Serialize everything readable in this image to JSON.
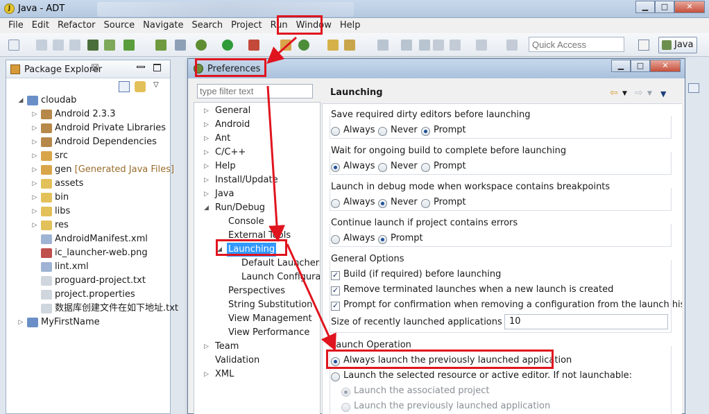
{
  "window": {
    "title": "Java - ADT",
    "app_icon_glyph": "J"
  },
  "menu": [
    "File",
    "Edit",
    "Refactor",
    "Source",
    "Navigate",
    "Search",
    "Project",
    "Run",
    "Window",
    "Help"
  ],
  "toolbar": {
    "quick_access_placeholder": "Quick Access",
    "perspective_label": "Java"
  },
  "package_explorer": {
    "tab_label": "Package Explorer",
    "tab_close": "☒",
    "items": [
      {
        "label": "cloudab",
        "level": 0,
        "arrow": "◢",
        "icon_color": "#6a8fc7"
      },
      {
        "label": "Android 2.3.3",
        "level": 1,
        "arrow": "▷",
        "icon_color": "#b6884a"
      },
      {
        "label": "Android Private Libraries",
        "level": 1,
        "arrow": "▷",
        "icon_color": "#b6884a"
      },
      {
        "label": "Android Dependencies",
        "level": 1,
        "arrow": "▷",
        "icon_color": "#b6884a"
      },
      {
        "label": "src",
        "level": 1,
        "arrow": "▷",
        "icon_color": "#d9a54a"
      },
      {
        "label": "gen",
        "decor": "[Generated Java Files]",
        "level": 1,
        "arrow": "▷",
        "icon_color": "#d9a54a"
      },
      {
        "label": "assets",
        "level": 1,
        "arrow": "▷",
        "icon_color": "#e3c15a"
      },
      {
        "label": "bin",
        "level": 1,
        "arrow": "▷",
        "icon_color": "#e3c15a"
      },
      {
        "label": "libs",
        "level": 1,
        "arrow": "▷",
        "icon_color": "#e3c15a"
      },
      {
        "label": "res",
        "level": 1,
        "arrow": "▷",
        "icon_color": "#e3c15a"
      },
      {
        "label": "AndroidManifest.xml",
        "level": 1,
        "arrow": "",
        "icon_color": "#9fb4d4"
      },
      {
        "label": "ic_launcher-web.png",
        "level": 1,
        "arrow": "",
        "icon_color": "#c0504d"
      },
      {
        "label": "lint.xml",
        "level": 1,
        "arrow": "",
        "icon_color": "#9fb4d4"
      },
      {
        "label": "proguard-project.txt",
        "level": 1,
        "arrow": "",
        "icon_color": "#d0d6de"
      },
      {
        "label": "project.properties",
        "level": 1,
        "arrow": "",
        "icon_color": "#d0d6de"
      },
      {
        "label": "数据库创建文件在如下地址.txt",
        "level": 1,
        "arrow": "",
        "icon_color": "#d0d6de"
      },
      {
        "label": "MyFirstName",
        "level": 0,
        "arrow": "▷",
        "icon_color": "#6a8fc7"
      }
    ]
  },
  "preferences": {
    "title": "Preferences",
    "filter_placeholder": "type filter text",
    "tree": [
      {
        "label": "General",
        "level": 0,
        "arrow": "▷"
      },
      {
        "label": "Android",
        "level": 0,
        "arrow": "▷"
      },
      {
        "label": "Ant",
        "level": 0,
        "arrow": "▷"
      },
      {
        "label": "C/C++",
        "level": 0,
        "arrow": "▷"
      },
      {
        "label": "Help",
        "level": 0,
        "arrow": "▷"
      },
      {
        "label": "Install/Update",
        "level": 0,
        "arrow": "▷"
      },
      {
        "label": "Java",
        "level": 0,
        "arrow": "▷"
      },
      {
        "label": "Run/Debug",
        "level": 0,
        "arrow": "◢"
      },
      {
        "label": "Console",
        "level": 1,
        "arrow": ""
      },
      {
        "label": "External Tools",
        "level": 1,
        "arrow": ""
      },
      {
        "label": "Launching",
        "level": 1,
        "arrow": "◢",
        "selected": true
      },
      {
        "label": "Default Launchers",
        "level": 2,
        "arrow": ""
      },
      {
        "label": "Launch Configurations",
        "level": 2,
        "arrow": ""
      },
      {
        "label": "Perspectives",
        "level": 1,
        "arrow": ""
      },
      {
        "label": "String Substitution",
        "level": 1,
        "arrow": ""
      },
      {
        "label": "View Management",
        "level": 1,
        "arrow": ""
      },
      {
        "label": "View Performance",
        "level": 1,
        "arrow": ""
      },
      {
        "label": "Team",
        "level": 0,
        "arrow": "▷"
      },
      {
        "label": "Validation",
        "level": 0,
        "arrow": ""
      },
      {
        "label": "XML",
        "level": 0,
        "arrow": "▷"
      }
    ],
    "page_title": "Launching",
    "save_dirty": {
      "title": "Save required dirty editors before launching",
      "options": [
        "Always",
        "Never",
        "Prompt"
      ],
      "selected": "Prompt"
    },
    "wait_build": {
      "title": "Wait for ongoing build to complete before launching",
      "options": [
        "Always",
        "Never",
        "Prompt"
      ],
      "selected": "Always"
    },
    "debug_mode": {
      "title": "Launch in debug mode when workspace contains breakpoints",
      "options": [
        "Always",
        "Never",
        "Prompt"
      ],
      "selected": "Never"
    },
    "continue_errors": {
      "title": "Continue launch if project contains errors",
      "options": [
        "Always",
        "Prompt"
      ],
      "selected": "Prompt"
    },
    "general_options": {
      "title": "General Options",
      "checks": [
        "Build (if required) before launching",
        "Remove terminated launches when a new launch is created",
        "Prompt for confirmation when removing a configuration from the launch history"
      ],
      "size_label": "Size of recently launched applications list:",
      "size_value": "10"
    },
    "launch_operation": {
      "title": "Launch Operation",
      "opt_always": "Always launch the previously launched application",
      "opt_selected": "Launch the selected resource or active editor. If not launchable:",
      "sub_associated": "Launch the associated project",
      "sub_previous": "Launch the previously launched application"
    }
  },
  "colors": {
    "annotation_red": "#e0141e",
    "selection_blue": "#3399ff"
  }
}
